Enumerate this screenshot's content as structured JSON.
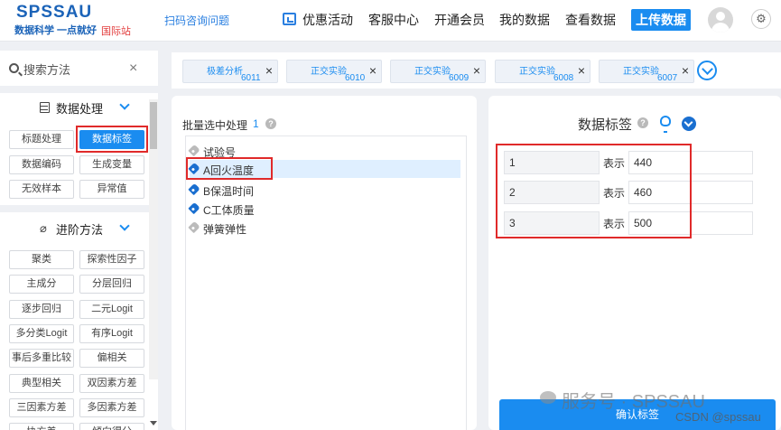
{
  "header": {
    "logo": "SPSSAU",
    "slogan": "数据科学 一点就好",
    "intl": "国际站",
    "scan_link": "扫码咨询问题",
    "nav": [
      "优惠活动",
      "客服中心",
      "开通会员",
      "我的数据",
      "查看数据"
    ],
    "upload": "上传数据",
    "settings_glyph": "⚙"
  },
  "sidebar": {
    "search_placeholder": "搜索方法",
    "clear": "×",
    "section1": "数据处理",
    "section1_items": [
      "标题处理",
      "数据标签",
      "数据编码",
      "生成变量",
      "无效样本",
      "异常值"
    ],
    "section2": "进阶方法",
    "section2_items": [
      "聚类",
      "探索性因子",
      "主成分",
      "分层回归",
      "逐步回归",
      "二元Logit",
      "多分类Logit",
      "有序Logit",
      "事后多重比较",
      "偏相关",
      "典型相关",
      "双因素方差",
      "三因素方差",
      "多因素方差",
      "协方差",
      "倾向得分"
    ]
  },
  "tabs": [
    {
      "name": "极差分析",
      "id": "6011"
    },
    {
      "name": "正交实验",
      "id": "6010"
    },
    {
      "name": "正交实验",
      "id": "6009"
    },
    {
      "name": "正交实验",
      "id": "6008"
    },
    {
      "name": "正交实验",
      "id": "6007"
    }
  ],
  "batch": {
    "label": "批量选中处理",
    "count": "1"
  },
  "variables": [
    "试验号",
    "A回火温度",
    "B保温时间",
    "C工体质量",
    "弹簧弹性"
  ],
  "labels_panel": {
    "title": "数据标签",
    "rows": [
      {
        "code": "1",
        "mid": "表示",
        "value": "440"
      },
      {
        "code": "2",
        "mid": "表示",
        "value": "460"
      },
      {
        "code": "3",
        "mid": "表示",
        "value": "500"
      }
    ],
    "confirm": "确认标签"
  },
  "watermark": {
    "text": "服务号 · SPSSAU",
    "csdn": "CSDN @spssau"
  },
  "colors": {
    "accent": "#1a8cf0",
    "highlight_border": "#e02a2a"
  }
}
